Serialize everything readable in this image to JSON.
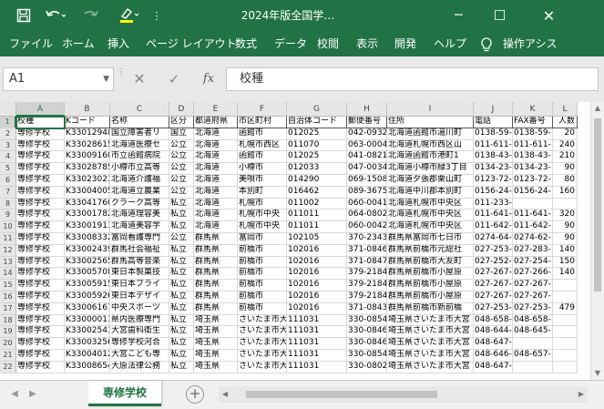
{
  "title_bar": {
    "title": "2024年版全国学…",
    "save_icon": "save-icon",
    "undo_icon": "undo-icon",
    "redo_icon": "redo-icon",
    "highlight_icon": "highlighter-icon",
    "accent": "#217346"
  },
  "ribbon": {
    "tabs": [
      "ファイル",
      "ホーム",
      "挿入",
      "ページ レイアウト",
      "数式",
      "データ",
      "校閲",
      "表示",
      "開発",
      "ヘルプ",
      "操作アシス"
    ]
  },
  "formula_bar": {
    "name_box": "A1",
    "fx_label": "fx",
    "content": "校種"
  },
  "columns": [
    "A",
    "B",
    "C",
    "D",
    "E",
    "F",
    "G",
    "H",
    "I",
    "J",
    "K",
    "L"
  ],
  "row_numbers": [
    "1",
    "2",
    "3",
    "4",
    "5",
    "6",
    "7",
    "8",
    "9",
    "10",
    "11",
    "12",
    "13",
    "14",
    "15",
    "16",
    "17",
    "18",
    "19",
    "20",
    "21",
    "22"
  ],
  "rows": [
    [
      "校種",
      "Kコード",
      "名称",
      "区分",
      "都道府県",
      "市区町村",
      "自治体コード",
      "郵便番号",
      "住所",
      "電話",
      "FAX番号",
      "人数"
    ],
    [
      "専修学校",
      "K33012948",
      "国立障害者リ",
      "国立",
      "北海道",
      "函館市",
      "012025",
      "042-0932",
      "北海道函館市湯川町",
      "0138-59-",
      "0138-59-",
      "20"
    ],
    [
      "専修学校",
      "K33028615",
      "北海道医療セ",
      "公立",
      "北海道",
      "札幌市西区",
      "011070",
      "063-0004",
      "北海道札幌市西区山",
      "011-611-",
      "011-611-",
      "240"
    ],
    [
      "専修学校",
      "K33009160",
      "市立函館病院",
      "公立",
      "北海道",
      "函館市",
      "012025",
      "041-0821",
      "北海道函館市港町1",
      "0138-43-",
      "0138-43-",
      "210"
    ],
    [
      "専修学校",
      "K33028785",
      "小樽市立高等",
      "公立",
      "北海道",
      "小樽市",
      "012033",
      "047-0034",
      "北海道小樽市緑3丁目",
      "0134-23-",
      "0134-23-",
      "90"
    ],
    [
      "専修学校",
      "K33023023",
      "北海道介護福",
      "公立",
      "北海道",
      "美唄市",
      "014290",
      "069-1508",
      "北海道夕張郡栗山町",
      "0123-72-",
      "0123-72-",
      "80"
    ],
    [
      "専修学校",
      "K33004005",
      "北海道立農業",
      "公立",
      "北海道",
      "本別町",
      "016462",
      "089-3675",
      "北海道中川郡本別町",
      "0156-24-",
      "0156-24-",
      "160"
    ],
    [
      "専修学校",
      "K33041760",
      "クラーク高等",
      "私立",
      "北海道",
      "札幌市",
      "011002",
      "060-0041",
      "北海道札幌市中央区",
      "011-233-",
      "",
      ""
    ],
    [
      "専修学校",
      "K33001782",
      "北海道理容美",
      "私立",
      "北海道",
      "札幌市中央",
      "011011",
      "064-0802",
      "北海道札幌市中央区",
      "011-641-",
      "011-641-",
      "320"
    ],
    [
      "専修学校",
      "K33001913",
      "北海道美容学",
      "私立",
      "北海道",
      "札幌市中央",
      "011011",
      "060-0042",
      "北海道札幌市中央区",
      "011-642-",
      "011-642-",
      "90"
    ],
    [
      "専修学校",
      "K33008332",
      "富岡看護専門",
      "公立",
      "群馬県",
      "富岡市",
      "102105",
      "370-2343",
      "群馬県富岡市七日市",
      "0274-64-",
      "0274-62-",
      "90"
    ],
    [
      "専修学校",
      "K33002439",
      "群馬社会福祉",
      "私立",
      "群馬県",
      "前橋市",
      "102016",
      "371-0846",
      "群馬県前橋市元総社",
      "027-253-",
      "027-283-",
      "140"
    ],
    [
      "専修学校",
      "K33002565",
      "群馬高等音楽",
      "私立",
      "群馬県",
      "前橋市",
      "102016",
      "371-0847",
      "群馬県前橋市大友町",
      "027-252-",
      "027-254-",
      "150"
    ],
    [
      "専修学校",
      "K33005708",
      "東日本製菓技",
      "私立",
      "群馬県",
      "前橋市",
      "102016",
      "379-2184",
      "群馬県前橋市小屋原",
      "027-267-",
      "027-266-",
      "140"
    ],
    [
      "専修学校",
      "K33005915",
      "東日本ブライ",
      "私立",
      "群馬県",
      "前橋市",
      "102016",
      "379-2184",
      "群馬県前橋市小屋原",
      "027-267-",
      "027-267-",
      ""
    ],
    [
      "専修学校",
      "K33005926",
      "東日本デザイ",
      "私立",
      "群馬県",
      "前橋市",
      "102016",
      "379-2184",
      "群馬県前橋市小屋原",
      "027-267-",
      "027-267-",
      ""
    ],
    [
      "専修学校",
      "K33006167",
      "中央スポーツ",
      "私立",
      "群馬県",
      "前橋市",
      "102016",
      "371-0843",
      "群馬県前橋市新前橋",
      "027-253-",
      "027-253-",
      "479"
    ],
    [
      "専修学校",
      "K33000013",
      "県内医療専門",
      "私立",
      "埼玉県",
      "さいたま市大",
      "111031",
      "330-0854",
      "埼玉県さいたま市大宮",
      "048-658-",
      "048-658-",
      ""
    ],
    [
      "専修学校",
      "K33002543",
      "大宮歯科衛生",
      "私立",
      "埼玉県",
      "さいたま市大",
      "111031",
      "330-0846",
      "埼玉県さいたま市大宮",
      "048-644-",
      "048-645-",
      ""
    ],
    [
      "専修学校",
      "K33003256",
      "専修学校河合",
      "私立",
      "埼玉県",
      "さいたま市大",
      "111031",
      "330-0846",
      "埼玉県さいたま市大宮",
      "048-647-",
      "",
      ""
    ],
    [
      "専修学校",
      "K33004012",
      "大宮こども専",
      "私立",
      "埼玉県",
      "さいたま市大",
      "111031",
      "330-0854",
      "埼玉県さいたま市大宮",
      "048-646-",
      "048-657-",
      ""
    ],
    [
      "専修学校",
      "K33008654",
      "大原法律公務",
      "私立",
      "埼玉県",
      "さいたま市大",
      "111031",
      "330-0802",
      "埼玉県さいたま市大宮",
      "048-647-",
      "",
      ""
    ]
  ],
  "sheets": {
    "active": "専修学校",
    "add_icon": "plus-circle-icon"
  }
}
